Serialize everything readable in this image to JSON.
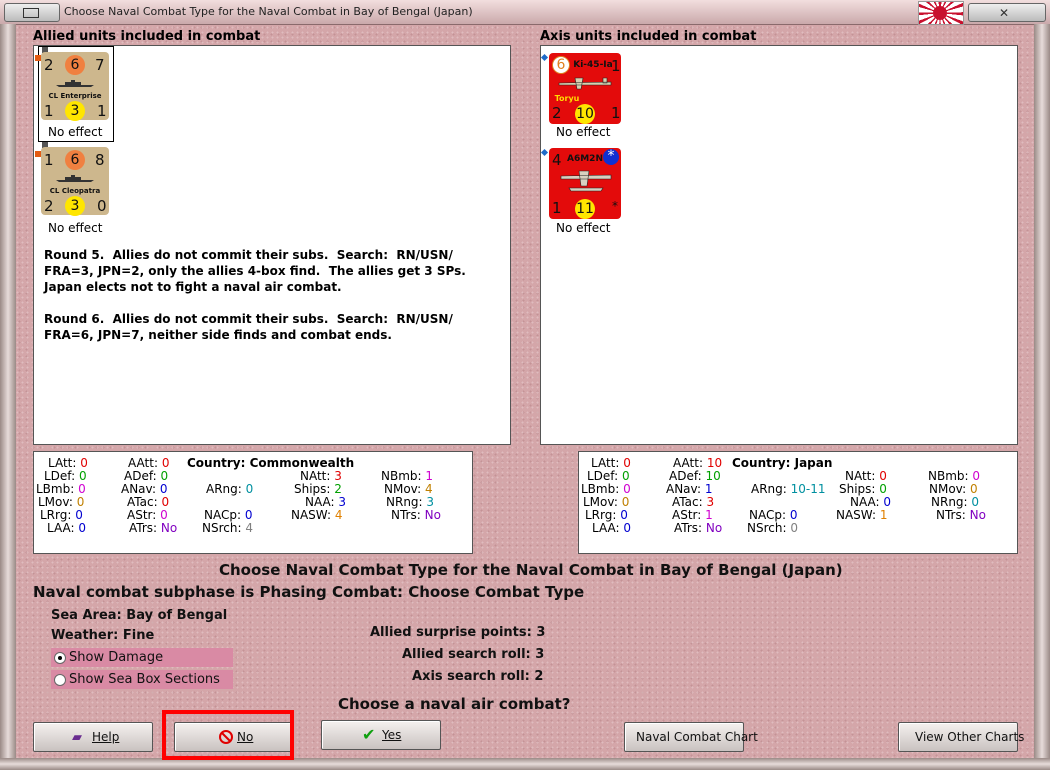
{
  "window": {
    "title": "Choose Naval Combat Type for the Naval Combat in Bay of Bengal (Japan)"
  },
  "allied": {
    "header": "Allied units included in combat",
    "units": [
      {
        "name": "CL Enterprise",
        "tl": "2",
        "tc": "6",
        "tr": "7",
        "bl": "1",
        "bc": "3",
        "br": "1",
        "effect": "No effect"
      },
      {
        "name": "CL Cleopatra",
        "tl": "1",
        "tc": "6",
        "tr": "8",
        "bl": "2",
        "bc": "3",
        "br": "0",
        "effect": "No effect"
      }
    ],
    "log": [
      "Round 5.  Allies do not commit their subs.  Search:  RN/USN/",
      "FRA=3, JPN=2, only the allies 4-box find.  The allies get 3 SPs.",
      "Japan elects not to fight a naval air combat.",
      "",
      "Round 6.  Allies do not commit their subs.  Search:  RN/USN/",
      "FRA=6, JPN=7, neither side finds and combat ends."
    ]
  },
  "axis": {
    "header": "Axis units included in combat",
    "units": [
      {
        "name": "Ki-45-Ia",
        "sub": "Toryu",
        "tl": "6",
        "tr": "1",
        "bl": "2",
        "bc": "10",
        "br": "1",
        "effect": "No effect"
      },
      {
        "name": "A6M2N",
        "sub": "",
        "tl": "4",
        "tr": "*",
        "bl": "1",
        "bc": "11",
        "br": "*",
        "effect": "No effect"
      }
    ]
  },
  "allied_stats": {
    "country_label": "Country:",
    "country": "Commonwealth",
    "LAtt": "0",
    "AAtt": "0",
    "LDef": "0",
    "ADef": "0",
    "NAtt": "3",
    "NBmb": "1",
    "LBmb": "0",
    "ANav": "0",
    "ARng": "0",
    "Ships": "2",
    "NMov": "4",
    "LMov": "0",
    "ATac": "0",
    "NAA": "3",
    "NRng": "3",
    "LRrg": "0",
    "AStr": "0",
    "NACp": "0",
    "NASW": "4",
    "NTrs": "No",
    "LAA": "0",
    "ATrs": "No",
    "NSrch": "4"
  },
  "axis_stats": {
    "country_label": "Country:",
    "country": "Japan",
    "LAtt": "0",
    "AAtt": "10",
    "LDef": "0",
    "ADef": "10",
    "NAtt": "0",
    "NBmb": "0",
    "LBmb": "0",
    "ANav": "1",
    "ARng": "10-11",
    "Ships": "0",
    "NMov": "0",
    "LMov": "0",
    "ATac": "3",
    "NAA": "0",
    "NRng": "0",
    "LRrg": "0",
    "AStr": "1",
    "NACp": "0",
    "NASW": "1",
    "NTrs": "No",
    "LAA": "0",
    "ATrs": "No",
    "NSrch": "0"
  },
  "labels": {
    "LAtt": "LAtt:",
    "AAtt": "AAtt:",
    "LDef": "LDef:",
    "ADef": "ADef:",
    "NAtt": "NAtt:",
    "NBmb": "NBmb:",
    "LBmb": "LBmb:",
    "ANav": "ANav:",
    "ARng": "ARng:",
    "Ships": "Ships:",
    "NMov": "NMov:",
    "LMov": "LMov:",
    "ATac": "ATac:",
    "NAA": "NAA:",
    "NRng": "NRng:",
    "LRrg": "LRrg:",
    "AStr": "AStr:",
    "NACp": "NACp:",
    "NASW": "NASW:",
    "NTrs": "NTrs:",
    "LAA": "LAA:",
    "ATrs": "ATrs:",
    "NSrch": "NSrch:"
  },
  "main": {
    "heading": "Choose Naval Combat Type for the Naval Combat in Bay of Bengal (Japan)",
    "subphase": "Naval combat subphase is Phasing Combat: Choose Combat Type",
    "sea_area_label": "Sea Area:",
    "sea_area": "Bay of Bengal",
    "weather_label": "Weather:",
    "weather": "Fine",
    "show_damage": "Show Damage",
    "show_sea_box": "Show Sea Box Sections",
    "surprise_label": "Allied surprise points:",
    "surprise": "3",
    "allied_search_label": "Allied search roll:",
    "allied_search": "3",
    "axis_search_label": "Axis search roll:",
    "axis_search": "2",
    "question": "Choose a naval air combat?"
  },
  "buttons": {
    "help": "Help",
    "no": "No",
    "yes": "Yes",
    "chart": "Naval Combat Chart",
    "other": "View Other Charts"
  },
  "colors": {
    "accent_highlight": "#ff0000",
    "axis_counter": "#e30b0b",
    "allied_counter": "#cdb78d",
    "option_bg": "#d98aa4"
  }
}
